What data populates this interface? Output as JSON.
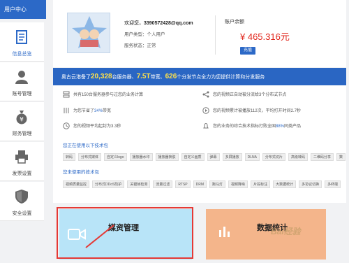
{
  "sidebar": {
    "header": "用户中心",
    "items": [
      {
        "label": "信息总览",
        "icon": "document-icon",
        "active": true
      },
      {
        "label": "账号管理",
        "icon": "user-icon",
        "active": false
      },
      {
        "label": "财务管理",
        "icon": "money-bag-icon",
        "active": false
      },
      {
        "label": "发票设置",
        "icon": "printer-icon",
        "active": false
      },
      {
        "label": "安全设置",
        "icon": "shield-icon",
        "active": false
      }
    ]
  },
  "user": {
    "welcome": "欢迎您，",
    "email": "3390572428@qq.com",
    "type": "用户类型：个人用户",
    "status": "服务状态：正常"
  },
  "account": {
    "balance_label": "账户余额",
    "balance": "¥ 465.316元",
    "recharge": "充值"
  },
  "banner": {
    "prefix": "奥古云港备了",
    "servers": "20,328",
    "mid1": "台服务器、",
    "bandwidth": "7.5T",
    "mid2": "带宽、",
    "nodes": "626",
    "suffix": "个分发节点全力为您提供计算和分发服务"
  },
  "stats": {
    "s1": "共有150台服务器参与过您的业务计算",
    "s2": "您的视频正自动被分流给3个分布式节点",
    "s3a": "为您节省了",
    "s3b": "34%",
    "s3c": "带宽",
    "s4": "您的视频累计被播放112次，平均打开时间2.7秒",
    "s5": "您的视频平均起封为3.3秒",
    "s6a": "您的业务的综合技术指标打败全国",
    "s6b": "88%",
    "s6c": "同类产品"
  },
  "using_title": "您正在使用以下技术包",
  "using_tags": [
    "转码",
    "分布式媒体",
    "自定义logo",
    "播放器水印",
    "播放器换肤",
    "自定义画质",
    "弹幕",
    "多屏播放",
    "DLNA",
    "分布式切片",
    "高级转码",
    "二维码分享",
    "数"
  ],
  "unused_title": "您未使用的技术包",
  "unused_tags": [
    "视频质量监控",
    "分布式DDoS防护",
    "关键帧检测",
    "流量过滤",
    "RTSP",
    "DRM",
    "跑马灯",
    "视频降噪",
    "片段标注",
    "大数据统计",
    "多协议切换",
    "多终端"
  ],
  "tiles": {
    "media": "媒资管理",
    "stats": "数据统计"
  },
  "watermark": "Bai经验",
  "colors": {
    "primary": "#2c69c7",
    "balance": "#e1251b",
    "media_tile": "#b8e4f8",
    "stats_tile": "#f4b58b",
    "highlight": "#e53935"
  }
}
